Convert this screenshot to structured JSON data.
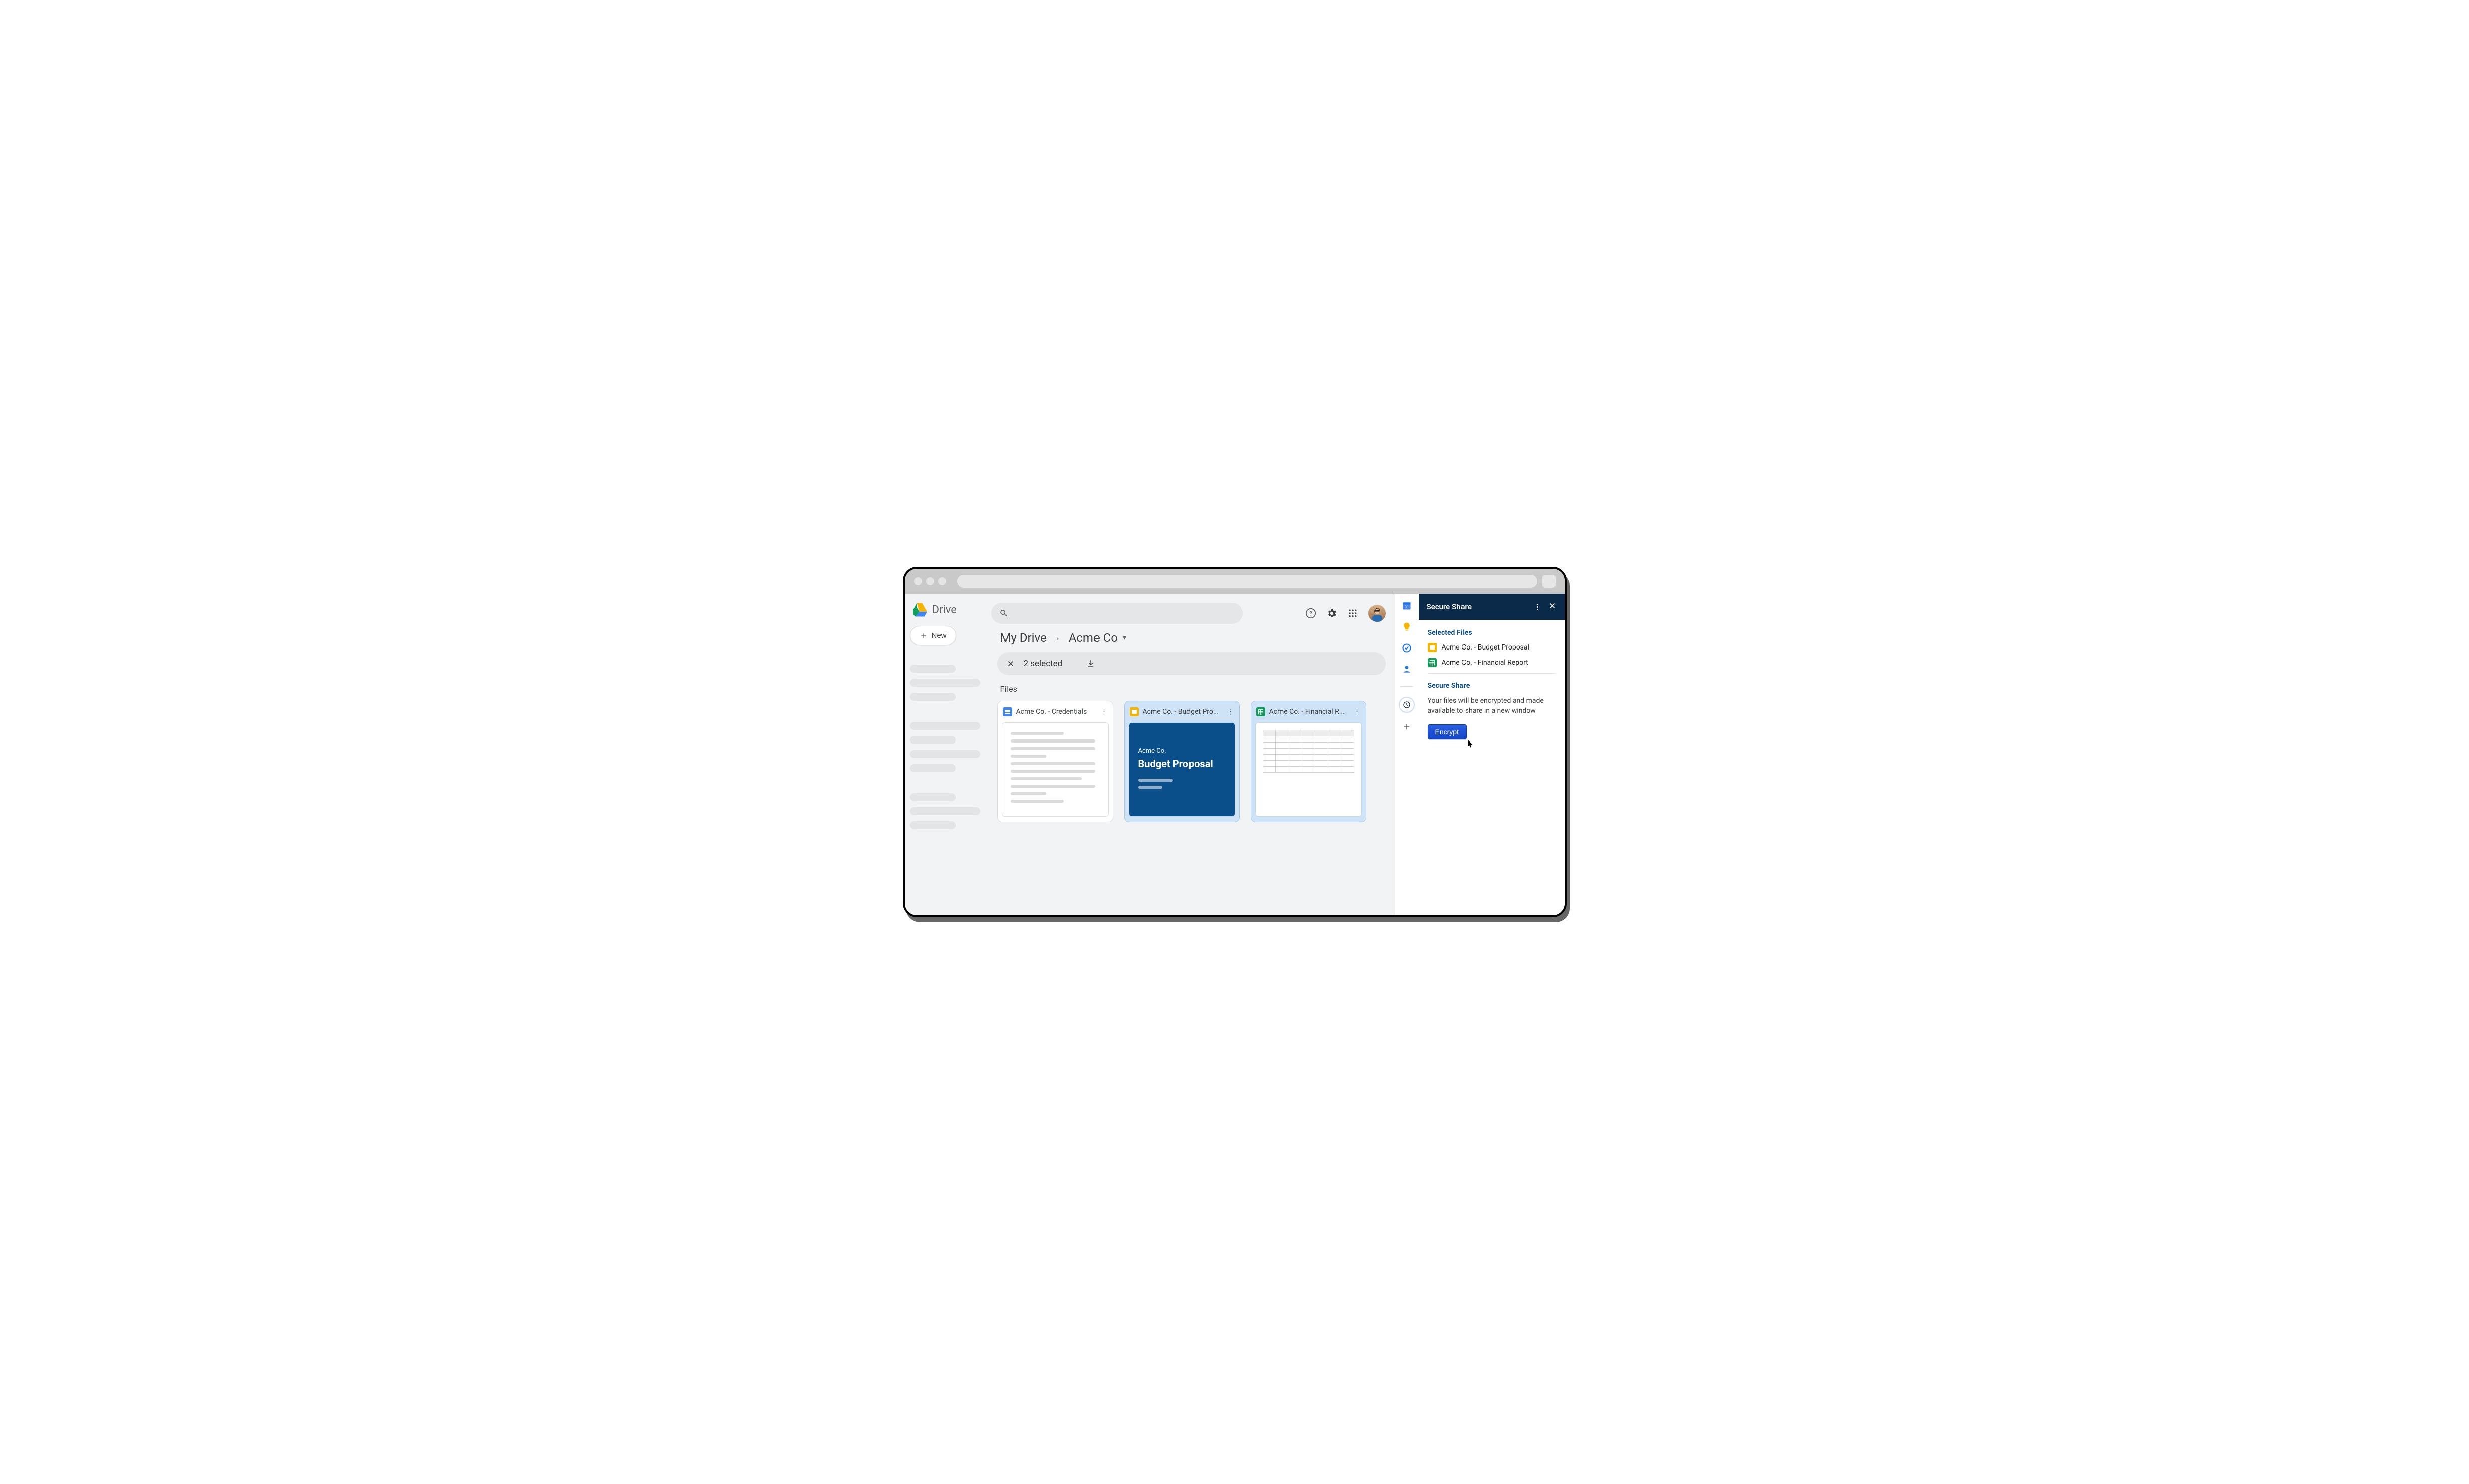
{
  "app": {
    "name": "Drive"
  },
  "sidebar": {
    "new_label": "New"
  },
  "breadcrumb": {
    "root": "My Drive",
    "folder": "Acme Co"
  },
  "selection_bar": {
    "count_label": "2 selected"
  },
  "section": {
    "files_label": "Files"
  },
  "files": [
    {
      "type": "docs",
      "title": "Acme Co. - Credentials",
      "selected": false
    },
    {
      "type": "slides",
      "title": "Acme Co. - Budget Pro...",
      "selected": true,
      "preview": {
        "subtitle": "Acme Co.",
        "headline": "Budget Proposal"
      }
    },
    {
      "type": "sheets",
      "title": "Acme Co. -  Financial R...",
      "selected": true
    }
  ],
  "panel": {
    "title": "Secure Share",
    "selected_heading": "Selected Files",
    "selected_files": [
      {
        "type": "slides",
        "name": "Acme Co. - Budget Proposal"
      },
      {
        "type": "sheets",
        "name": "Acme Co. -  Financial Report"
      }
    ],
    "action_heading": "Secure Share",
    "action_description": "Your files will be encrypted and made available to share in a new window",
    "button_label": "Encrypt"
  }
}
